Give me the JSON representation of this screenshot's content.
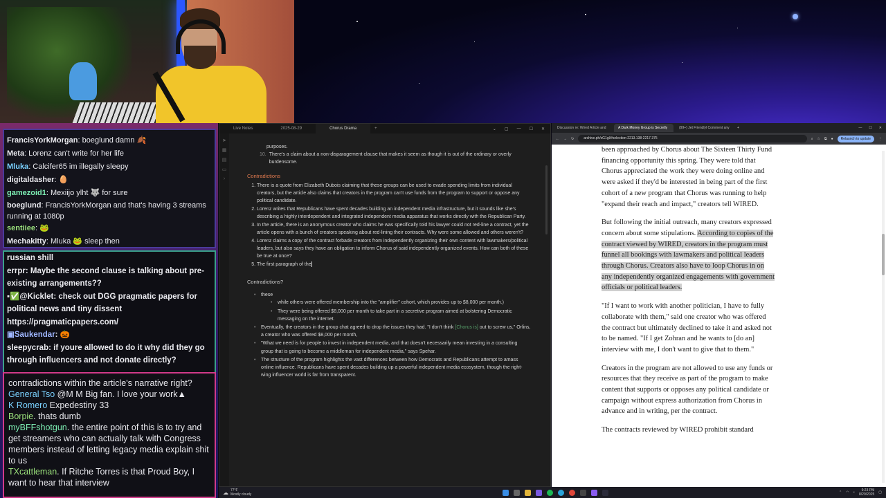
{
  "chat_top": {
    "messages": [
      {
        "user": "FrancisYorkMorgan",
        "text": ": boeglund damn",
        "emote": "🍂",
        "color": "#e9e9ee"
      },
      {
        "user": "Meta",
        "text": ": Lorenz can't write for her life",
        "emote": "",
        "color": "#e9e9ee"
      },
      {
        "user": "Mluka",
        "text": ": Calcifer65 im illegally sleepy",
        "emote": "",
        "color": "#7ad1ff"
      },
      {
        "user": "digitaldasher",
        "text": ":",
        "emote": "🥚",
        "color": "#e9e9ee"
      },
      {
        "user": "gamezoid1",
        "text": ": Mexiijo ylht",
        "emote": "🐺 for sure",
        "color": "#7ef0b5"
      },
      {
        "user": "boeglund",
        "text": ": FrancisYorkMorgan and that's having 3 streams running at 1080p",
        "emote": "",
        "color": "#e9e9ee"
      },
      {
        "user": "sentiiee",
        "text": ":",
        "emote": "🐸",
        "color": "#9be27c"
      },
      {
        "user": "Mechakitty",
        "text": ": Mluka",
        "emote": "🐸 sleep then",
        "color": "#e9e9ee"
      }
    ]
  },
  "chat_mid": {
    "messages": [
      {
        "user": "",
        "text": "russian shill",
        "color": "#e9e9ee"
      },
      {
        "user": "errpr",
        "text": ":  Maybe the second clause is talking about pre-existing arrangements??",
        "color": "#e9e9ee"
      },
      {
        "user": "▪✅@Kicklet",
        "text": ":  check out DGG pragmatic papers for political news and tiny dissent https://pragmaticpapers.com/",
        "color": "#e9e9ee"
      },
      {
        "user": "▣Saukendar",
        "text": ":  🎃",
        "color": "#9fb6ff"
      },
      {
        "user": "sleepycrab",
        "text": ":  if youre allowed to do it why did they go through influencers and not donate directly?",
        "color": "#e9e9ee"
      }
    ]
  },
  "chat_bottom": {
    "messages": [
      {
        "user": "",
        "text": "contradictions within the article's narrative right?",
        "color": "#e9e9ee"
      },
      {
        "user": "General Tso",
        "text": " @M M Big fan. I love your work▲",
        "color": "#7ad1ff"
      },
      {
        "user": "K Romero",
        "text": " Expedestiny 33",
        "color": "#7ad1ff"
      },
      {
        "user": "Borpie",
        "text": ". thats dumb",
        "color": "#9be27c"
      },
      {
        "user": "myBFFshotgun",
        "text": ". the entire point of this is to try and get streamers who can actually talk with Congress members instead of letting legacy media explain shit to us",
        "color": "#7ef0b5"
      },
      {
        "user": "TXcattleman",
        "text": ". If Ritche Torres is that Proud Boy, I want to hear that interview",
        "color": "#9be27c"
      }
    ]
  },
  "notes_window": {
    "tabs": [
      "Live Notes",
      "2025-08-29",
      "Chorus Drama",
      "+"
    ],
    "window_controls": [
      "⌄",
      "▢",
      "—",
      "☐",
      "✕"
    ],
    "top_items": [
      "purposes.",
      "There's a claim about a non-disparagement clause that makes it seem as though it is out of the ordinary or overly burdensome."
    ],
    "top_item_number": "10.",
    "contradictions_heading": "Contradictions",
    "contradictions": [
      "There is a quote from Elizabeth Dubois claiming that these groups can be used to evade spending limits from individual creators, but the article also claims that creators in the program can't use funds from the program to support or oppose any political candidate.",
      "Lorenz writes that Republicans have spent decades building an independent media infrastructure, but it sounds like she's describing a highly interdependent and integrated independent media apparatus that works directly with the Republican Party.",
      "In the article, there is an anonymous creator who claims he was specifically told his lawyer could not red-line a contract, yet the article opens with a bunch of creators speaking about red-lining their contracts. Why were some allowed and others weren't?",
      "Lorenz claims a copy of the contract forbade creators from independently organizing their own content with lawmakers/political leaders, but also says they have an obligation to inform Chorus of said independently organized events. How can both of these be true at once?",
      "The first paragraph of the"
    ],
    "contradictions2_heading": "Contradictions?",
    "bullets_label": "these",
    "sub_bullets": [
      "while others were offered membership into the \"amplifier\" cohort, which provides up to $8,000 per month.)",
      "They were being offered $8,000 per month to take part in a secretive program aimed at bolstering Democratic messaging on the internet."
    ],
    "bullet_eventually_a": "Eventually, the creators in the group chat agreed to drop the issues they had. \"I don't think ",
    "bullet_eventually_hl": "[Chorus is]",
    "bullet_eventually_b": " out to screw us,\" Orlins, a creator who was offered $8,000 per month,",
    "bullet_invest": "\"What we need is for people to invest in independent media, and that doesn't necessarily mean investing in a consulting group that is going to become a middleman for independent media,\" says Spehar.",
    "bullet_structure": "The structure of the program highlights the vast differences between how Democrats and Republicans attempt to amass online influence. Republicans have spent decades building up a powerful independent media ecosystem, though the right-wing influencer world is far from transparent."
  },
  "browser": {
    "tabs": [
      "Discussion re: Wired Article and",
      "A Dark Money Group is Secretly",
      "(99+) Jet Friendlyl Comment any"
    ],
    "new_tab": "+",
    "url": "archive.ph/sG1gl/#selection-2213.138-2217.375",
    "update_label": "Relaunch to update",
    "paragraphs": [
      "been approached by Chorus about The Sixteen Thirty Fund financing opportunity this spring. They were told that Chorus appreciated the work they were doing online and were asked if they'd be interested in being part of the first cohort of a new program that Chorus was running to help \"expand their reach and impact,\" creators tell WIRED.",
      "\"If I want to work with another politician, I have to fully collaborate with them,\" said one creator who was offered the contract but ultimately declined to take it and asked not to be named. \"If I get Zohran and he wants to [do an] interview with me, I don't want to give that to them.\"",
      "Creators in the program are not allowed to use any funds or resources that they receive as part of the program to make content that supports or opposes any political candidate or campaign without express authorization from Chorus in advance and in writing, per the contract.",
      "The contracts reviewed by WIRED prohibit standard"
    ],
    "para2_plain": "But following the initial outreach, many creators expressed concern about some stipulations. ",
    "para2_selected": "According to copies of the contract viewed by WIRED, creators in the program must funnel all bookings with lawmakers and political leaders through Chorus. Creators also have to loop Chorus in on any independently organized engagements with government officials or political leaders."
  },
  "taskbar": {
    "weather_temp": "77°F",
    "weather_desc": "Mostly cloudy",
    "time": "9:23 PM",
    "date": "8/29/2025"
  },
  "colors": {
    "accent_heading": "#e07a4f",
    "obsidian_bg": "#1e1e1e",
    "selection": "#cfcfcf"
  }
}
